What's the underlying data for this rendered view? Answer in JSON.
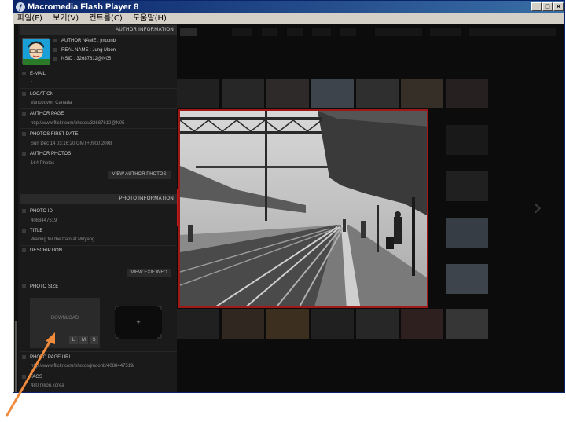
{
  "window": {
    "title": "Macromedia Flash Player 8",
    "menu": [
      "파일(F)",
      "보기(V)",
      "컨트롤(C)",
      "도움말(H)"
    ],
    "buttons": {
      "minimize": "_",
      "maximize": "□",
      "close": "×"
    }
  },
  "author": {
    "header": "AUTHOR INFORMATION",
    "name_label": "AUTHOR NAME : jmoonb",
    "real_name_label": "REAL NAME :  Jung Moon",
    "nsid_label": "NSID : 32687612@N05",
    "email_label": "E-MAIL",
    "email_value": "-",
    "location_label": "LOCATION",
    "location_value": "Vancouver, Canada",
    "page_label": "AUTHOR PAGE",
    "page_value": "http://www.flickr.com/photos/32687612@N05",
    "first_date_label": "PHOTOS FIRST DATE",
    "first_date_value": "Sun Dec 14 03:16:20 GMT+0900 2008",
    "photos_label": "AUTHOR PHOTOS",
    "photos_value": "164 Photos",
    "view_button": "VIEW AUTHOR PHOTOS"
  },
  "photo": {
    "header": "PHOTO INFORMATION",
    "id_label": "PHOTO ID",
    "id_value": "4088447519",
    "title_label": "TITLE",
    "title_value": "Waiting for the train at Miryang",
    "desc_label": "DESCRIPTION",
    "desc_value": "-",
    "exif_button": "VIEW EXIF INFO",
    "size_label": "PHOTO SIZE",
    "download_label": "DOWNLOAD",
    "sizes": [
      "L",
      "M",
      "S"
    ],
    "preview_plus": "+",
    "url_label": "PHOTO PAGE URL",
    "url_value": "http://www.flickr.com/photos/jmoonb/4088447519/",
    "tags_label": "TAGS",
    "tags_value": "480,nikon,korea"
  },
  "gallery": {
    "prev": "‹",
    "next": "›"
  },
  "icons": {
    "app": "flash-player-icon",
    "pointer": "arrow-annotation-icon",
    "pointer_color": "#f08a3c",
    "accent": "#c41a1a"
  }
}
